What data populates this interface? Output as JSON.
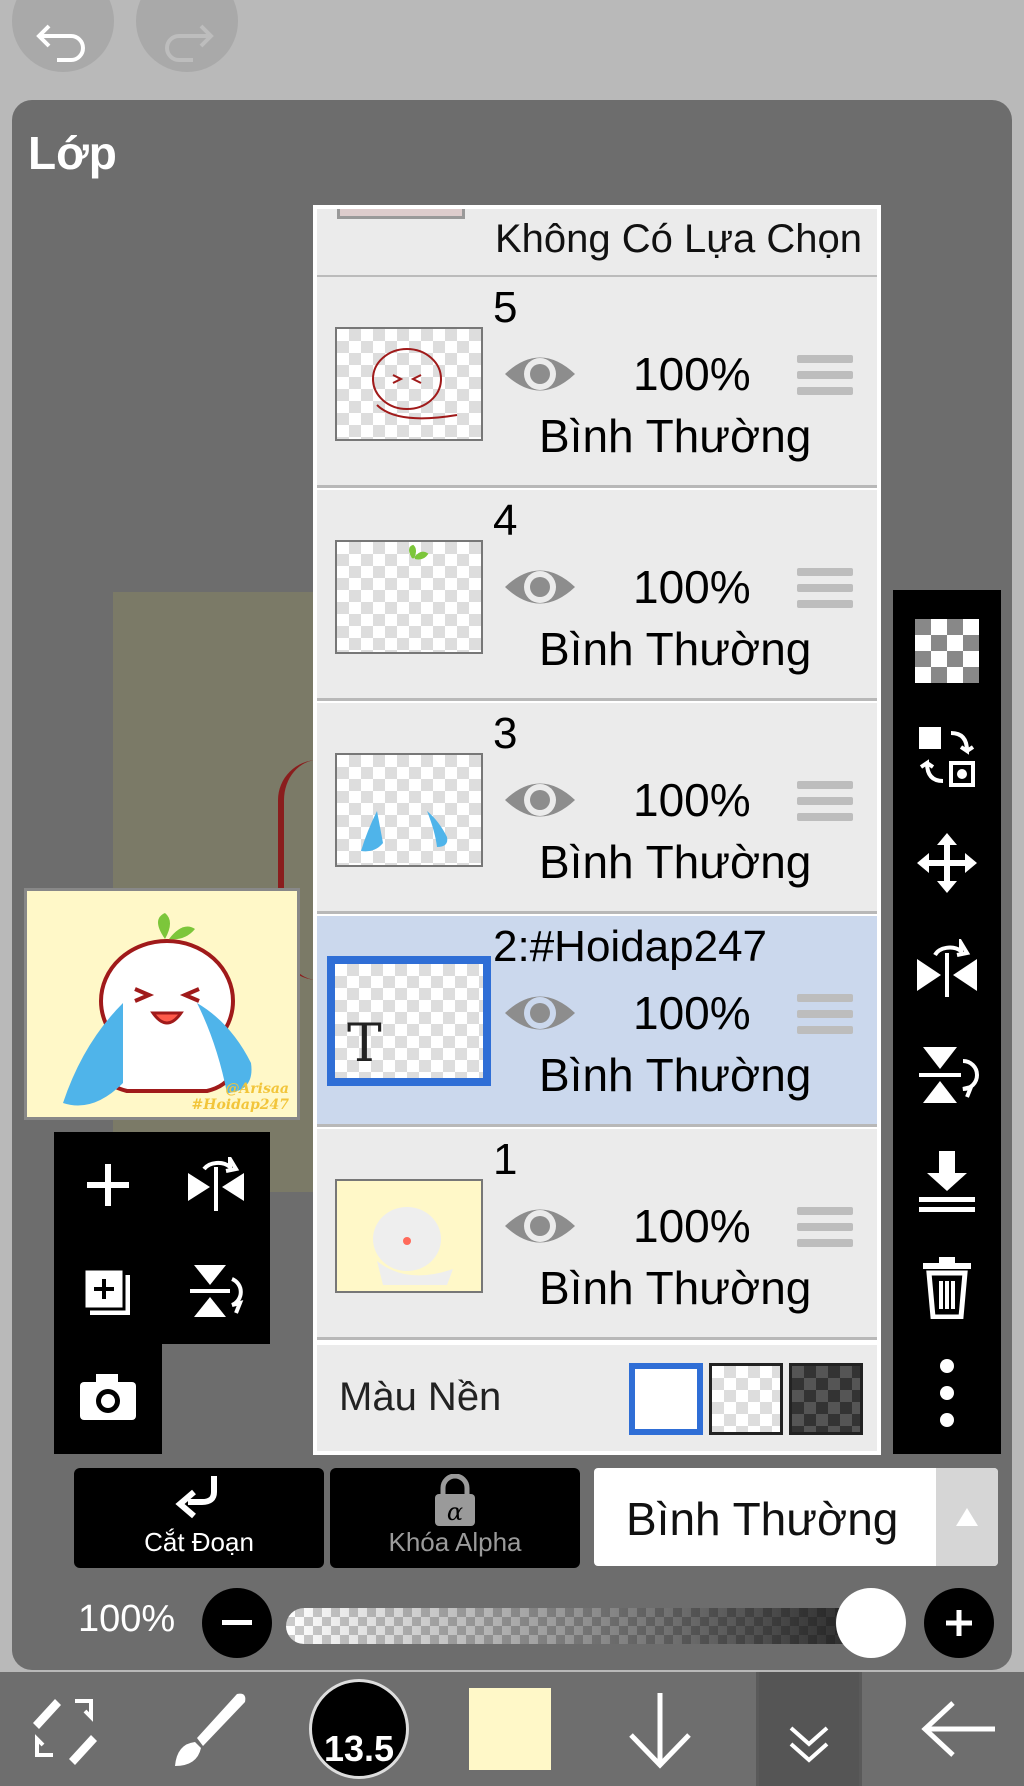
{
  "panel": {
    "title": "Lớp"
  },
  "preview": {
    "credit_line1": "@Arisaa",
    "credit_line2": "#Hoidap247"
  },
  "layers": {
    "selection_label": "Không Có Lựa Chọn",
    "items": [
      {
        "name": "5",
        "opacity": "100%",
        "blend": "Bình Thường"
      },
      {
        "name": "4",
        "opacity": "100%",
        "blend": "Bình Thường"
      },
      {
        "name": "3",
        "opacity": "100%",
        "blend": "Bình Thường"
      },
      {
        "name": "2:#Hoidap247",
        "opacity": "100%",
        "blend": "Bình Thường",
        "selected": true,
        "thumb_text": "T"
      },
      {
        "name": "1",
        "opacity": "100%",
        "blend": "Bình Thường"
      }
    ],
    "background_label": "Màu Nền"
  },
  "controls": {
    "clip_label": "Cắt Đoạn",
    "alpha_lock_label": "Khóa Alpha",
    "blend_mode": "Bình Thường",
    "opacity": "100%"
  },
  "toolbar": {
    "brush_size": "13.5",
    "current_color": "#fff8c8"
  },
  "colors": {
    "accent": "#2f6ed6",
    "panel": "#6d6d6d",
    "selected_row": "#cbd8ed"
  }
}
